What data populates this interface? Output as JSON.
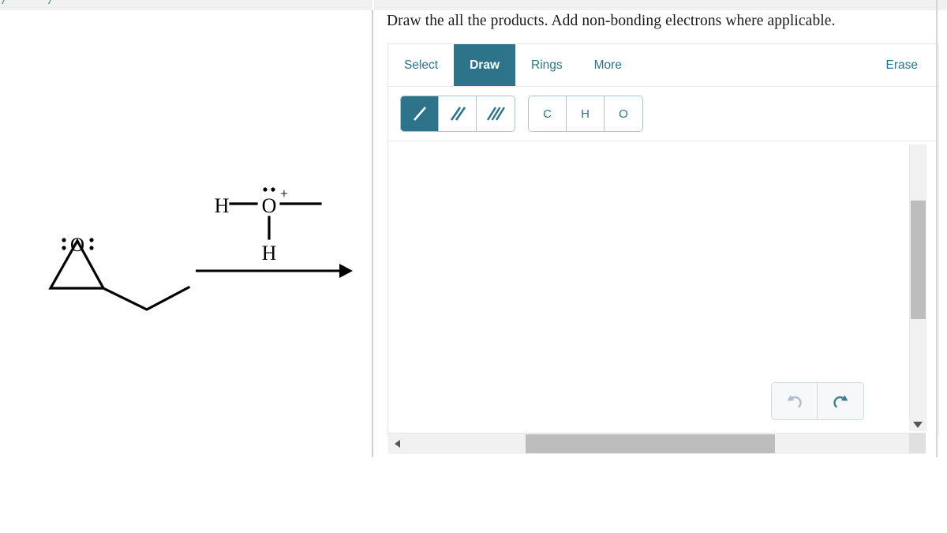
{
  "prompt": {
    "text": "Draw the all the products. Add non-bonding electrons where applicable."
  },
  "editor": {
    "menu": [
      {
        "label": "Select",
        "active": false
      },
      {
        "label": "Draw",
        "active": true
      },
      {
        "label": "Rings",
        "active": false
      },
      {
        "label": "More",
        "active": false
      }
    ],
    "erase_label": "Erase",
    "bond_tools": [
      {
        "name": "single-bond",
        "glyph": "/",
        "active": true
      },
      {
        "name": "double-bond",
        "glyph": "//",
        "active": false
      },
      {
        "name": "triple-bond",
        "glyph": "///",
        "active": false
      }
    ],
    "atom_tools": [
      {
        "label": "C",
        "active": false
      },
      {
        "label": "H",
        "active": false
      },
      {
        "label": "O",
        "active": false
      }
    ],
    "history": [
      {
        "name": "undo-button",
        "icon": "undo-icon",
        "enabled": false
      },
      {
        "name": "redo-button",
        "icon": "redo-icon",
        "enabled": true
      }
    ],
    "zoom_controls": [
      {
        "name": "zoom-in-button",
        "icon": "magnifier-plus-icon"
      },
      {
        "name": "zoom-reset-button",
        "icon": "magnifier-reset-icon"
      },
      {
        "name": "zoom-out-button",
        "icon": "magnifier-minus-icon"
      }
    ]
  },
  "reaction_scheme": {
    "reactant": {
      "name": "1,2-epoxypentane-like epoxide",
      "oxygen_label": "O",
      "lone_pair_dots": 4,
      "description": "epoxide ring fused to a zig-zag alkyl chain"
    },
    "reagent": {
      "name": "protonated methanol (methyloxonium ion)",
      "left_atom": "H",
      "center_atom": "O",
      "charge": "+",
      "bottom_atom": "H",
      "lone_pair_dots": 2
    },
    "arrow": {
      "name": "reaction-arrow",
      "direction": "right"
    }
  },
  "colors": {
    "accent": "#2d7389",
    "accent_border": "#a9c5d2",
    "panel_border": "#e2e5e7",
    "scrollbar_thumb": "#bdbdbd",
    "strip_bg": "#f1f1f1",
    "structure_stroke": "#000000"
  },
  "scrollbars": {
    "vertical": {
      "name": "vertical-scrollbar",
      "thumb_position": "upper-middle"
    },
    "horizontal": {
      "name": "horizontal-scrollbar",
      "thumb_position": "center"
    }
  }
}
